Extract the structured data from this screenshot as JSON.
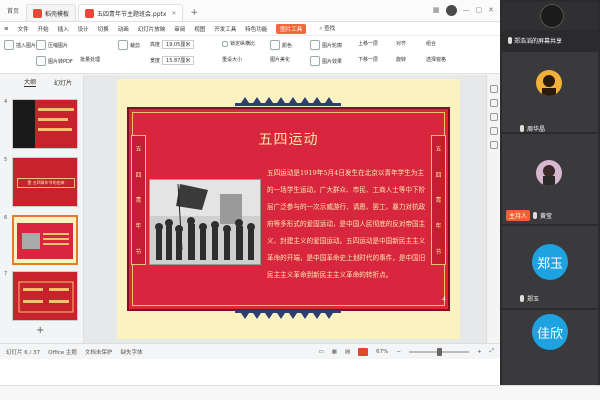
{
  "titlebar": {
    "home_tab": "首页",
    "tabs": [
      {
        "label": "稻壳模板",
        "color": "#e6493a"
      },
      {
        "label": "五四青年节主题班会.pptx",
        "color": "#e6493a"
      }
    ],
    "add_tab": "+"
  },
  "menubar": {
    "items": [
      "文件",
      "开始",
      "插入",
      "设计",
      "切换",
      "动画",
      "幻灯片放映",
      "审阅",
      "视图",
      "开发工具",
      "特色功能",
      "图片工具"
    ],
    "highlighted": "图片工具",
    "search": "查找"
  },
  "ribbon": {
    "height_label": "高度",
    "height_value": "19.05厘米",
    "width_label": "宽度",
    "width_value": "15.87厘米",
    "lock_ratio": "锁定纵横比",
    "reset_size": "重设大小",
    "crop": "裁剪",
    "insert_picture": "插入图片",
    "compress": "压缩图片",
    "to_pdf": "图片转PDF",
    "color": "颜色",
    "effects": "图片效果",
    "outline": "图片轮廓",
    "align": "对齐",
    "rotate": "旋转",
    "select": "选择窗格",
    "combine": "组合",
    "up": "上移一层",
    "down": "下移一层",
    "batch": "批量处理",
    "beautify": "图片美化"
  },
  "left_panel": {
    "tab_outline": "大纲",
    "tab_slides": "幻灯片",
    "thumbs": [
      {
        "num": "4"
      },
      {
        "num": "5",
        "text": "壹 五四青年节的由来"
      },
      {
        "num": "6"
      },
      {
        "num": "7"
      }
    ],
    "add_symbol": "+"
  },
  "slide": {
    "title": "五四运动",
    "side_chars": [
      "五",
      "四",
      "青",
      "年",
      "节"
    ],
    "body": "五四运动是1919年5月4日发生在北京以青年学生为主的一场学生运动，广大群众、市民、工商人士等中下阶层广泛参与的一次示威游行、请愿、罢工、暴力对抗政府等多形式的爱国运动，是中国人民彻底的反对帝国主义、封建主义的爱国运动。五四运动是中国新民主主义革命的开端，是中国革命史上划时代的事件，是中国旧民主主义革命到新民主主义革命的转折点。",
    "page_number": "4"
  },
  "statusbar": {
    "page": "幻灯片 6 / 37",
    "theme": "Office 主题",
    "backup": "文档未保护",
    "font_missing": "缺失字体",
    "zoom": "67%"
  },
  "meeting": {
    "share_label": "郑浩滔的屏幕共享",
    "participants": [
      {
        "name": "周华晶"
      },
      {
        "name": "黄莹",
        "tag": "主持人"
      },
      {
        "name": "郑玉",
        "initials": "郑玉"
      },
      {
        "name": "佳欣",
        "initials": "佳欣"
      }
    ],
    "avatar_color": "#1ea2e0",
    "tag_color": "#f55f33"
  },
  "colors": {
    "slide_red": "#d7263d",
    "slide_cream": "#fbf3bf",
    "accent_orange": "#f0683b"
  }
}
